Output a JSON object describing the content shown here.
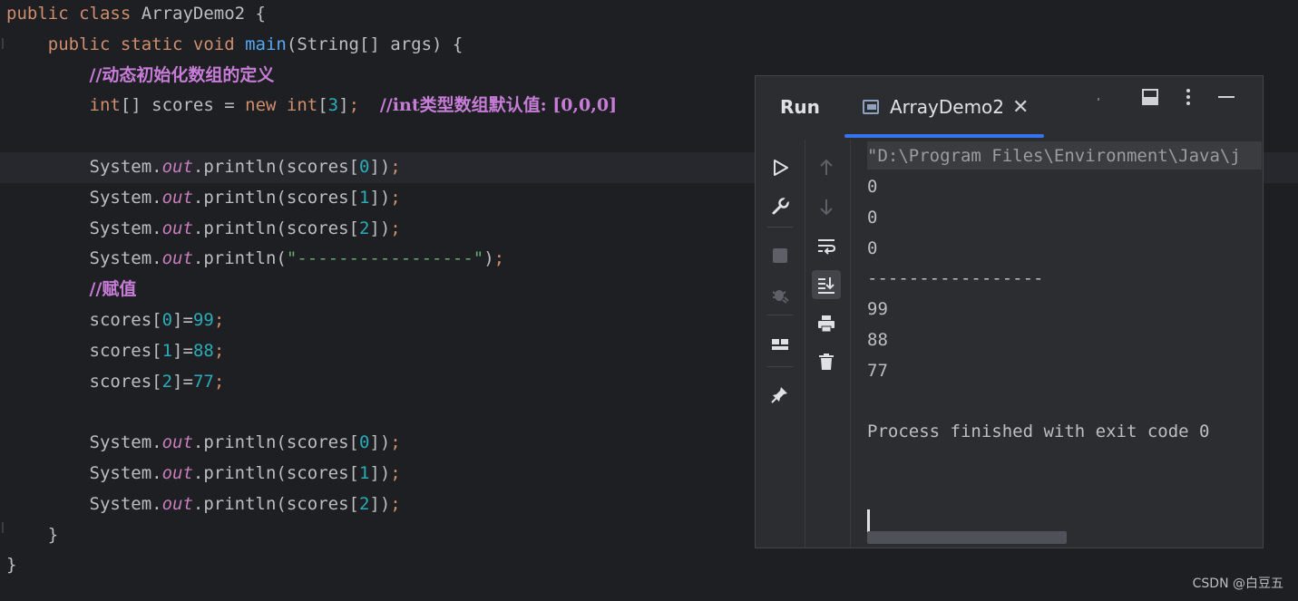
{
  "editor": {
    "lines": [
      {
        "segments": [
          {
            "t": "public class ",
            "c": "kw"
          },
          {
            "t": "ArrayDemo2 {",
            "c": ""
          }
        ]
      },
      {
        "segments": [
          {
            "t": "    public static void ",
            "c": "kw"
          },
          {
            "t": "main",
            "c": "fn"
          },
          {
            "t": "(String[] args) {",
            "c": ""
          }
        ]
      },
      {
        "segments": [
          {
            "t": "        ",
            "c": ""
          },
          {
            "t": "//动态初始化数组的定义",
            "c": "cm"
          }
        ]
      },
      {
        "segments": [
          {
            "t": "        int",
            "c": "kw"
          },
          {
            "t": "[] scores = ",
            "c": ""
          },
          {
            "t": "new int",
            "c": "kw"
          },
          {
            "t": "[",
            "c": ""
          },
          {
            "t": "3",
            "c": "num"
          },
          {
            "t": "]",
            "c": ""
          },
          {
            "t": ";",
            "c": "semi"
          },
          {
            "t": "  ",
            "c": ""
          },
          {
            "t": "//int类型数组默认值: [0,0,0]",
            "c": "cm"
          }
        ]
      },
      {
        "segments": []
      },
      {
        "segments": [
          {
            "t": "        System.",
            "c": ""
          },
          {
            "t": "out",
            "c": "it"
          },
          {
            "t": ".println(scores[",
            "c": ""
          },
          {
            "t": "0",
            "c": "num"
          },
          {
            "t": "])",
            "c": ""
          },
          {
            "t": ";",
            "c": "semi"
          }
        ],
        "current": true
      },
      {
        "segments": [
          {
            "t": "        System.",
            "c": ""
          },
          {
            "t": "out",
            "c": "it"
          },
          {
            "t": ".println(scores[",
            "c": ""
          },
          {
            "t": "1",
            "c": "num"
          },
          {
            "t": "])",
            "c": ""
          },
          {
            "t": ";",
            "c": "semi"
          }
        ]
      },
      {
        "segments": [
          {
            "t": "        System.",
            "c": ""
          },
          {
            "t": "out",
            "c": "it"
          },
          {
            "t": ".println(scores[",
            "c": ""
          },
          {
            "t": "2",
            "c": "num"
          },
          {
            "t": "])",
            "c": ""
          },
          {
            "t": ";",
            "c": "semi"
          }
        ]
      },
      {
        "segments": [
          {
            "t": "        System.",
            "c": ""
          },
          {
            "t": "out",
            "c": "it"
          },
          {
            "t": ".println(",
            "c": ""
          },
          {
            "t": "\"-----------------\"",
            "c": "str"
          },
          {
            "t": ")",
            "c": ""
          },
          {
            "t": ";",
            "c": "semi"
          }
        ]
      },
      {
        "segments": [
          {
            "t": "        ",
            "c": ""
          },
          {
            "t": "//赋值",
            "c": "cm"
          }
        ]
      },
      {
        "segments": [
          {
            "t": "        scores[",
            "c": ""
          },
          {
            "t": "0",
            "c": "num"
          },
          {
            "t": "]=",
            "c": ""
          },
          {
            "t": "99",
            "c": "num"
          },
          {
            "t": ";",
            "c": "semi"
          }
        ]
      },
      {
        "segments": [
          {
            "t": "        scores[",
            "c": ""
          },
          {
            "t": "1",
            "c": "num"
          },
          {
            "t": "]=",
            "c": ""
          },
          {
            "t": "88",
            "c": "num"
          },
          {
            "t": ";",
            "c": "semi"
          }
        ]
      },
      {
        "segments": [
          {
            "t": "        scores[",
            "c": ""
          },
          {
            "t": "2",
            "c": "num"
          },
          {
            "t": "]=",
            "c": ""
          },
          {
            "t": "77",
            "c": "num"
          },
          {
            "t": ";",
            "c": "semi"
          }
        ]
      },
      {
        "segments": []
      },
      {
        "segments": [
          {
            "t": "        System.",
            "c": ""
          },
          {
            "t": "out",
            "c": "it"
          },
          {
            "t": ".println(scores[",
            "c": ""
          },
          {
            "t": "0",
            "c": "num"
          },
          {
            "t": "])",
            "c": ""
          },
          {
            "t": ";",
            "c": "semi"
          }
        ]
      },
      {
        "segments": [
          {
            "t": "        System.",
            "c": ""
          },
          {
            "t": "out",
            "c": "it"
          },
          {
            "t": ".println(scores[",
            "c": ""
          },
          {
            "t": "1",
            "c": "num"
          },
          {
            "t": "])",
            "c": ""
          },
          {
            "t": ";",
            "c": "semi"
          }
        ]
      },
      {
        "segments": [
          {
            "t": "        System.",
            "c": ""
          },
          {
            "t": "out",
            "c": "it"
          },
          {
            "t": ".println(scores[",
            "c": ""
          },
          {
            "t": "2",
            "c": "num"
          },
          {
            "t": "])",
            "c": ""
          },
          {
            "t": ";",
            "c": "semi"
          }
        ]
      },
      {
        "segments": [
          {
            "t": "    }",
            "c": ""
          }
        ]
      },
      {
        "segments": [
          {
            "t": "}",
            "c": ""
          }
        ]
      }
    ]
  },
  "run_panel": {
    "title": "Run",
    "tab_label": "ArrayDemo2",
    "tab_close": "✕",
    "command": "\"D:\\Program Files\\Environment\\Java\\j",
    "output": [
      "0",
      "0",
      "0",
      "-----------------",
      "99",
      "88",
      "77",
      "",
      "Process finished with exit code 0"
    ],
    "header_icons": [
      "layout-icon",
      "more-icon",
      "minimize-icon"
    ],
    "toolbar_left": [
      "run-icon",
      "wrench-icon",
      "stop-icon",
      "debug-icon",
      "layout-icon",
      "pin-icon"
    ],
    "toolbar_right": [
      "up-arrow-icon",
      "down-arrow-icon",
      "soft-wrap-icon",
      "scroll-to-end-icon",
      "print-icon",
      "trash-icon"
    ]
  },
  "watermark": "CSDN @白豆五",
  "colors": {
    "background": "#1e1f22",
    "keyword": "#cf8e6d",
    "number": "#2aacb8",
    "comment": "#c77dd8",
    "accent": "#3574f0"
  }
}
